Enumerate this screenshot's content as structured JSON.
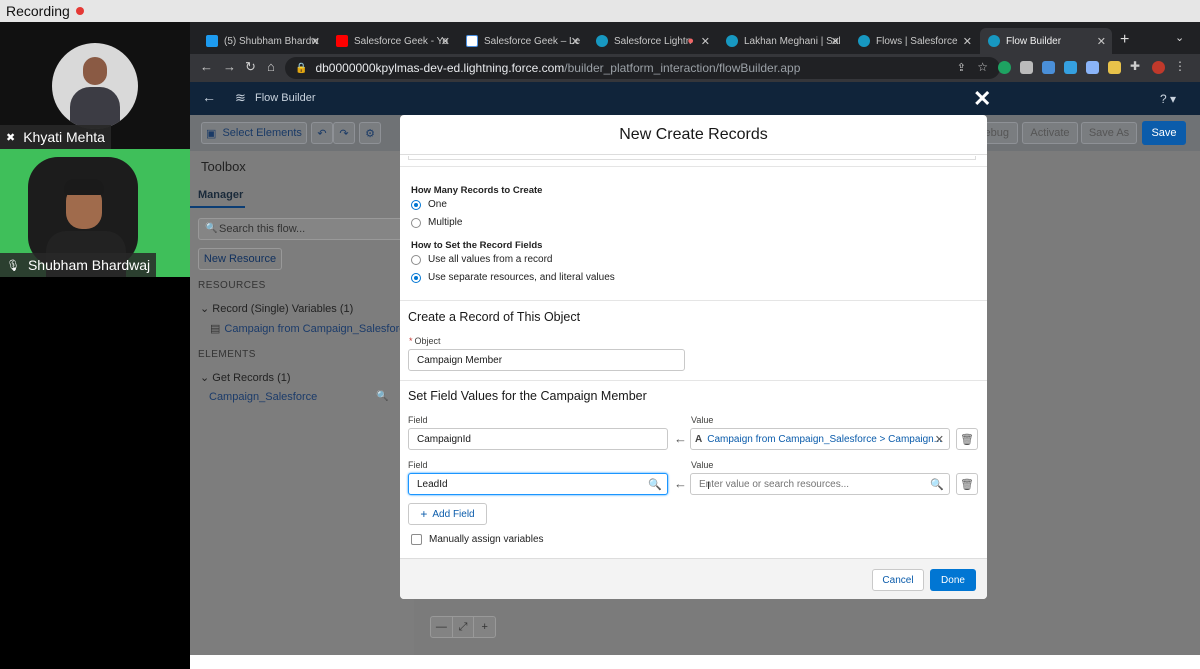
{
  "recording": {
    "label": "Recording"
  },
  "participants": [
    {
      "name": "Khyati Mehta"
    },
    {
      "name": "Shubham Bhardwaj"
    }
  ],
  "browser": {
    "tabs": [
      {
        "label": "(5) Shubham Bhardw",
        "color": "#1d9bf0"
      },
      {
        "label": "Salesforce Geek - Yo",
        "color": "#ff0000"
      },
      {
        "label": "Salesforce Geek – Le",
        "color": "#ffffff"
      },
      {
        "label": "Salesforce Lightn",
        "color": "#1798c1"
      },
      {
        "label": "Lakhan Meghani | Sal",
        "color": "#1798c1"
      },
      {
        "label": "Flows | Salesforce",
        "color": "#1798c1"
      },
      {
        "label": "Flow Builder",
        "color": "#1798c1"
      }
    ],
    "url_host": "db0000000kpylmas-dev-ed.lightning.force.com",
    "url_path": "/builder_platform_interaction/flowBuilder.app"
  },
  "app": {
    "title": "Flow Builder",
    "help": "?",
    "toolbar": {
      "select_elements": "Select Elements",
      "debug": "Debug",
      "activate": "Activate",
      "save_as": "Save As",
      "save": "Save"
    },
    "toolbox": {
      "title": "Toolbox",
      "tab": "Manager",
      "search_placeholder": "Search this flow...",
      "new_resource": "New Resource",
      "resources_heading": "RESOURCES",
      "record_group": "Record (Single) Variables (1)",
      "record_item": "Campaign from Campaign_Salesforce",
      "elements_heading": "ELEMENTS",
      "get_records_group": "Get Records (1)",
      "get_records_item": "Campaign_Salesforce"
    }
  },
  "modal": {
    "title": "New Create Records",
    "how_many_label": "How Many Records to Create",
    "how_many_options": [
      "One",
      "Multiple"
    ],
    "how_to_set_label": "How to Set the Record Fields",
    "how_to_set_options": [
      "Use all values from a record",
      "Use separate resources, and literal values"
    ],
    "create_section_title": "Create a Record of This Object",
    "object_label": "Object",
    "object_value": "Campaign Member",
    "field_values_title": "Set Field Values for the Campaign Member",
    "field_label": "Field",
    "value_label": "Value",
    "rows": [
      {
        "field": "CampaignId",
        "value": "Campaign from Campaign_Salesforce > Campaign..."
      },
      {
        "field": "LeadId",
        "value_placeholder": "Enter value or search resources..."
      }
    ],
    "add_field": "Add Field",
    "manual_assign": "Manually assign variables",
    "cancel": "Cancel",
    "done": "Done"
  }
}
